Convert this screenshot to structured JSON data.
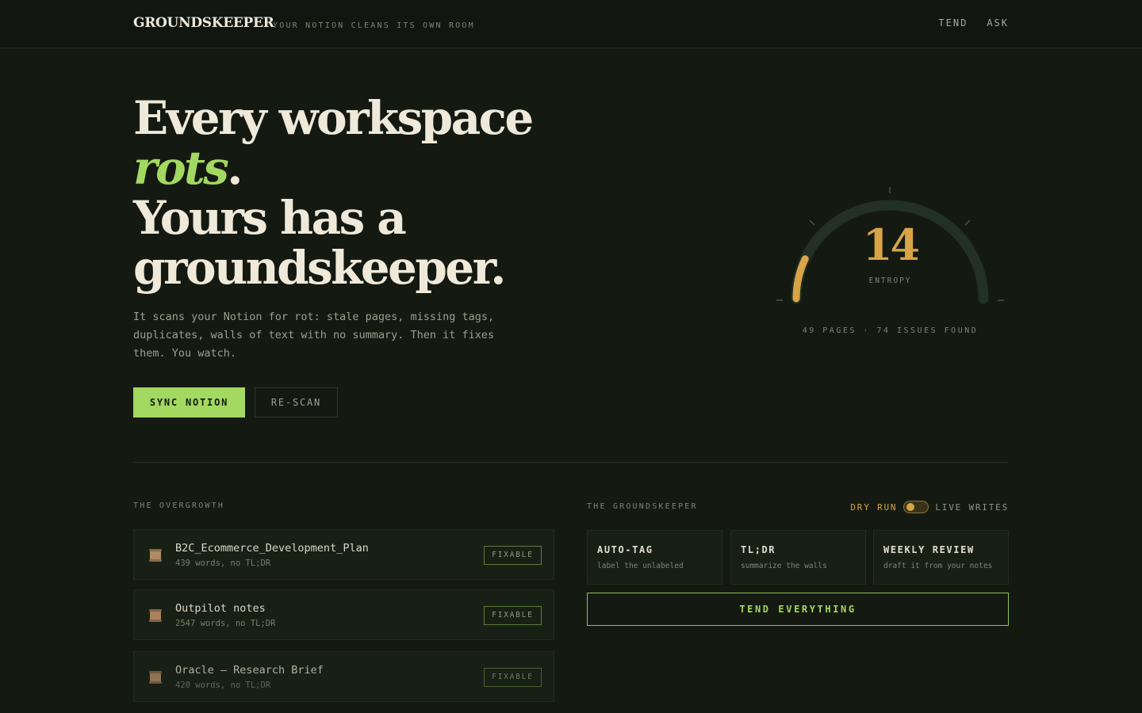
{
  "header": {
    "brand": "GROUNDSKEEPER",
    "tagline": "YOUR NOTION CLEANS ITS OWN ROOM",
    "nav": [
      "TEND",
      "ASK"
    ]
  },
  "hero": {
    "line1": "Every workspace",
    "rots": "rots",
    "period": ".",
    "line3": "Yours has a",
    "line4": "groundskeeper.",
    "lede": "It scans your Notion for rot: stale pages, missing tags, duplicates, walls of text with no summary. Then it fixes them. You watch.",
    "primary_cta": "SYNC NOTION",
    "secondary_cta": "RE-SCAN"
  },
  "gauge": {
    "value": "14",
    "label": "ENTROPY",
    "caption": "49 PAGES · 74 ISSUES FOUND",
    "fill_fraction": 0.14,
    "accent": "#d8a446"
  },
  "overgrowth": {
    "label": "THE OVERGROWTH",
    "items": [
      {
        "title": "B2C_Ecommerce_Development_Plan",
        "meta": "439 words, no TL;DR",
        "badge": "FIXABLE",
        "icon": "scroll-icon"
      },
      {
        "title": "Outpilot notes",
        "meta": "2547 words, no TL;DR",
        "badge": "FIXABLE",
        "icon": "scroll-icon"
      },
      {
        "title": "Oracle — Research Brief",
        "meta": "420 words, no TL;DR",
        "badge": "FIXABLE",
        "icon": "scroll-icon"
      }
    ]
  },
  "groundskeeper": {
    "label": "THE GROUNDSKEEPER",
    "mode_left": "DRY RUN",
    "mode_right": "LIVE WRITES",
    "tools": [
      {
        "name": "AUTO-TAG",
        "desc": "label the unlabeled"
      },
      {
        "name": "TL;DR",
        "desc": "summarize the walls"
      },
      {
        "name": "WEEKLY REVIEW",
        "desc": "draft it from your notes"
      }
    ],
    "tend_all": "TEND EVERYTHING"
  },
  "colors": {
    "background": "#141a12",
    "accent_green": "#a3d861",
    "accent_gold": "#d8a446"
  }
}
